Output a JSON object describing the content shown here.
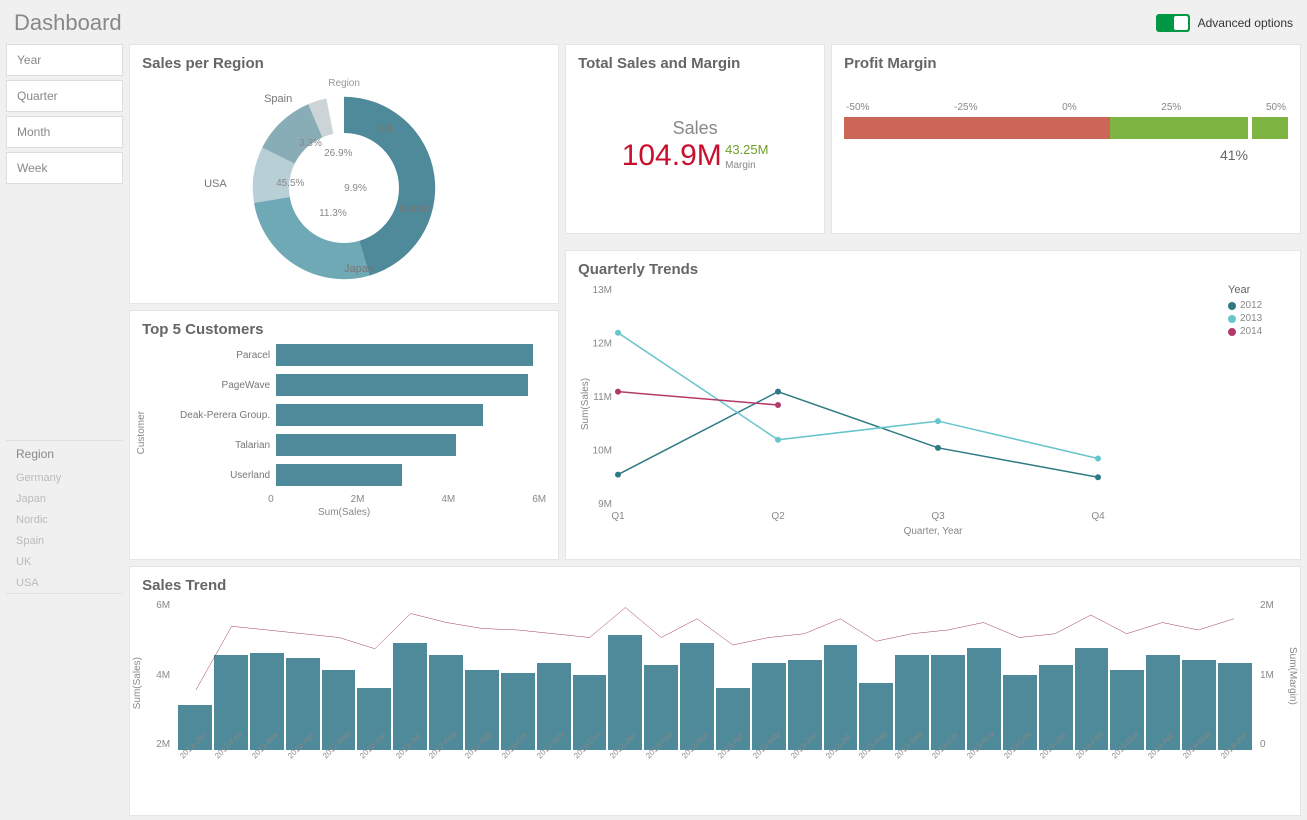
{
  "header": {
    "title": "Dashboard",
    "advanced_options": "Advanced options"
  },
  "filters": {
    "year": "Year",
    "quarter": "Quarter",
    "month": "Month",
    "week": "Week"
  },
  "region_filter": {
    "title": "Region",
    "items": [
      "Germany",
      "Japan",
      "Nordic",
      "Spain",
      "UK",
      "USA"
    ]
  },
  "cards": {
    "sales_region": "Sales per Region",
    "total_sales": "Total Sales and Margin",
    "profit_margin": "Profit Margin",
    "top5": "Top 5 Customers",
    "quarterly": "Quarterly Trends",
    "sales_trend": "Sales Trend"
  },
  "kpi": {
    "label": "Sales",
    "value": "104.9M",
    "margin_value": "43.25M",
    "margin_label": "Margin"
  },
  "gauge": {
    "ticks": [
      "-50%",
      "-25%",
      "0%",
      "25%",
      "50%"
    ],
    "value": "41%"
  },
  "chart_data": [
    {
      "type": "pie",
      "title": "Region",
      "series": [
        {
          "name": "Region",
          "values": [
            {
              "label": "USA",
              "value": 45.5
            },
            {
              "label": "UK",
              "value": 26.9
            },
            {
              "label": "Nordic",
              "value": 9.9
            },
            {
              "label": "Japan",
              "value": 11.3
            },
            {
              "label": "Spain",
              "value": 3.3
            }
          ]
        }
      ]
    },
    {
      "type": "bar",
      "title": "Top 5 Customers",
      "xlabel": "Sum(Sales)",
      "ylabel": "Customer",
      "categories": [
        "Paracel",
        "PageWave",
        "Deak-Perera Group.",
        "Talarian",
        "Userland"
      ],
      "values": [
        5.7,
        5.6,
        4.6,
        4.0,
        2.8
      ],
      "xlim": [
        0,
        6
      ],
      "xticks": [
        "0",
        "2M",
        "4M",
        "6M"
      ]
    },
    {
      "type": "line",
      "title": "Quarterly Trends",
      "xlabel": "Quarter, Year",
      "ylabel": "Sum(Sales)",
      "categories": [
        "Q1",
        "Q2",
        "Q3",
        "Q4"
      ],
      "ylim": [
        9,
        13
      ],
      "yticks": [
        "9M",
        "10M",
        "11M",
        "12M",
        "13M"
      ],
      "legend_title": "Year",
      "series": [
        {
          "name": "2012",
          "color": "#2e7a84",
          "values": [
            9.55,
            11.1,
            10.05,
            9.5
          ]
        },
        {
          "name": "2013",
          "color": "#67c5cc",
          "values": [
            12.2,
            10.2,
            10.55,
            9.85
          ]
        },
        {
          "name": "2014",
          "color": "#b23a6a",
          "values": [
            11.1,
            10.85,
            null,
            null
          ]
        }
      ]
    },
    {
      "type": "bar",
      "title": "Sales Trend",
      "ylabel": "Sum(Sales)",
      "ylabel2": "Sum(Margin)",
      "yticks": [
        "2M",
        "4M",
        "6M"
      ],
      "y2ticks": [
        "0",
        "1M",
        "2M"
      ],
      "categories": [
        "2012-Jan",
        "2012-Feb",
        "2012-Mar",
        "2012-Apr",
        "2012-May",
        "2012-Jun",
        "2012-Jul",
        "2012-Aug",
        "2012-Sep",
        "2012-Oct",
        "2012-Nov",
        "2012-Dec",
        "2013-Jan",
        "2013-Feb",
        "2013-Mar",
        "2013-Apr",
        "2013-May",
        "2013-Jun",
        "2013-Jul",
        "2013-Aug",
        "2013-Sep",
        "2013-Oct",
        "2013-Nov",
        "2013-Dec",
        "2014-Jan",
        "2014-Feb",
        "2014-Mar",
        "2014-Apr",
        "2014-May",
        "2014-Jun"
      ],
      "series": [
        {
          "name": "Sales",
          "type": "bar",
          "color": "#4e8a99",
          "values": [
            1.8,
            3.8,
            3.9,
            3.7,
            3.2,
            2.5,
            4.3,
            3.8,
            3.2,
            3.1,
            3.5,
            3.0,
            4.6,
            3.4,
            4.3,
            2.5,
            3.5,
            3.6,
            4.2,
            2.7,
            3.8,
            3.8,
            4.1,
            3.0,
            3.4,
            4.1,
            3.2,
            3.8,
            3.6,
            3.5
          ]
        },
        {
          "name": "Margin",
          "type": "line",
          "color": "#a03a5e",
          "values": [
            0.8,
            1.65,
            1.6,
            1.55,
            1.5,
            1.35,
            1.82,
            1.7,
            1.62,
            1.6,
            1.55,
            1.5,
            1.9,
            1.5,
            1.75,
            1.4,
            1.5,
            1.55,
            1.75,
            1.45,
            1.55,
            1.6,
            1.7,
            1.5,
            1.55,
            1.8,
            1.55,
            1.7,
            1.6,
            1.75
          ]
        }
      ]
    }
  ]
}
